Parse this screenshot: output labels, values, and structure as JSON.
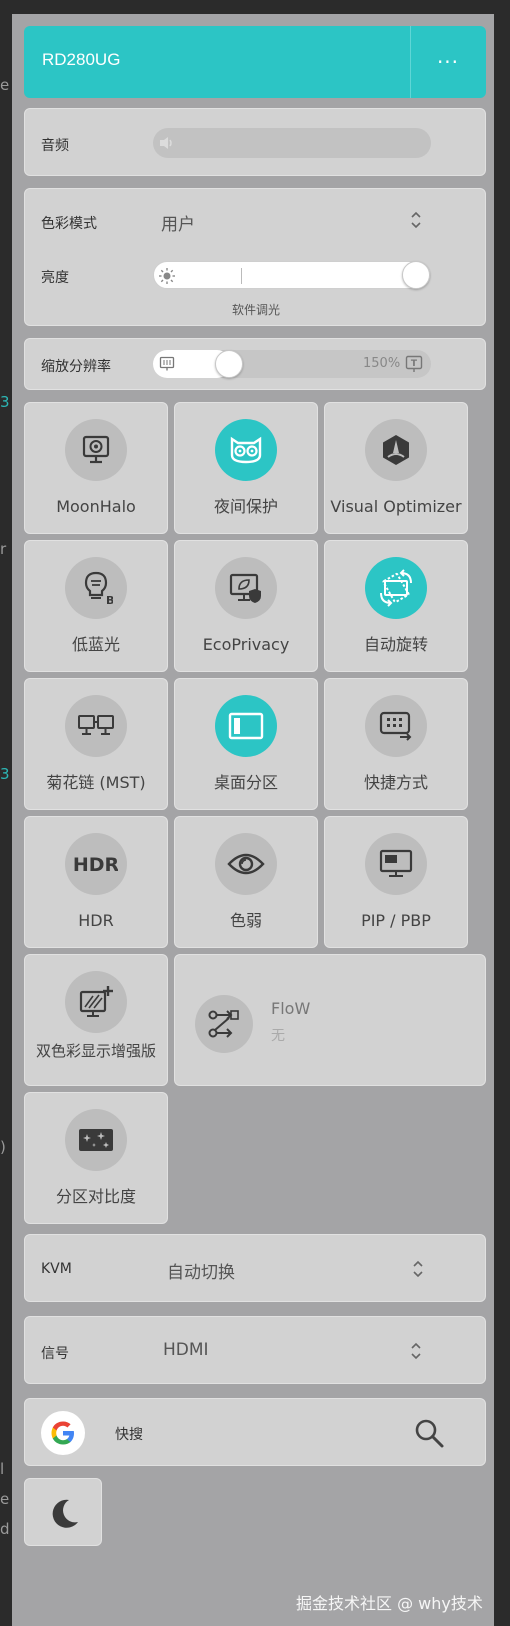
{
  "header": {
    "title": "RD280UG",
    "more_label": "···"
  },
  "audio": {
    "label": "音频"
  },
  "color_mode": {
    "label": "色彩模式",
    "value": "用户"
  },
  "brightness": {
    "label": "亮度",
    "sub_label": "软件调光",
    "level": 1.0
  },
  "scaling": {
    "label": "缩放分辨率",
    "value_text": "150%",
    "level": 0.25
  },
  "tiles": [
    {
      "label": "MoonHalo",
      "icon": "moonhalo-icon",
      "active": false
    },
    {
      "label": "夜间保护",
      "icon": "owl-icon",
      "active": true
    },
    {
      "label": "Visual Optimizer",
      "icon": "visual-optimizer-icon",
      "active": false
    },
    {
      "label": "低蓝光",
      "icon": "low-blue-light-icon",
      "active": false
    },
    {
      "label": "EcoPrivacy",
      "icon": "eco-privacy-icon",
      "active": false
    },
    {
      "label": "自动旋转",
      "icon": "auto-rotate-icon",
      "active": true
    },
    {
      "label": "菊花链 (MST)",
      "icon": "daisy-chain-icon",
      "active": false
    },
    {
      "label": "桌面分区",
      "icon": "desktop-partition-icon",
      "active": true
    },
    {
      "label": "快捷方式",
      "icon": "shortcut-icon",
      "active": false
    },
    {
      "label": "HDR",
      "icon": "hdr-icon",
      "active": false
    },
    {
      "label": "色弱",
      "icon": "eye-icon",
      "active": false
    },
    {
      "label": "PIP / PBP",
      "icon": "pip-icon",
      "active": false
    },
    {
      "label": "双色彩显示增强版",
      "icon": "dual-color-icon",
      "active": false
    },
    {
      "label": "分区对比度",
      "icon": "zone-contrast-icon",
      "active": false
    }
  ],
  "flow": {
    "label": "FloW",
    "value": "无"
  },
  "kvm": {
    "label": "KVM",
    "value": "自动切换"
  },
  "signal": {
    "label": "信号",
    "value": "HDMI"
  },
  "search": {
    "label": "快搜"
  },
  "watermark": "掘金技术社区 @ why技术",
  "colors": {
    "accent": "#2cc5c5",
    "panel": "#a4a4a6",
    "card": "#d2d2d2"
  }
}
